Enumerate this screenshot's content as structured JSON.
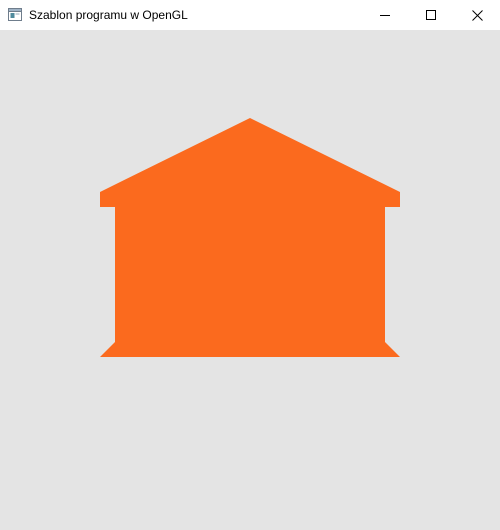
{
  "window": {
    "title": "Szablon programu w OpenGL",
    "icon": "opengl-app-icon",
    "controls": {
      "minimize_icon": "minimize-icon",
      "maximize_icon": "maximize-icon",
      "close_icon": "close-icon"
    }
  },
  "canvas": {
    "background_color": "#e4e4e4",
    "shape": {
      "kind": "house",
      "fill_color": "#fb6a1e"
    }
  }
}
